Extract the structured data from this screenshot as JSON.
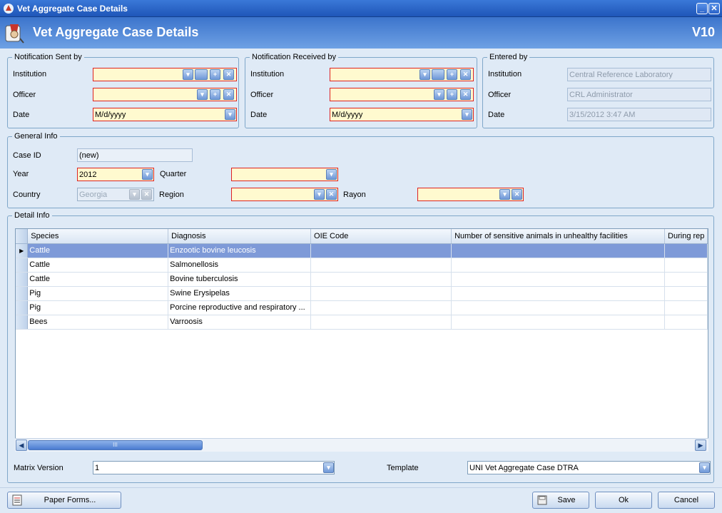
{
  "window": {
    "title": "Vet Aggregate Case Details"
  },
  "header": {
    "title": "Vet Aggregate Case Details",
    "version": "V10"
  },
  "sent_by": {
    "legend": "Notification Sent by",
    "institution_label": "Institution",
    "institution_value": "",
    "officer_label": "Officer",
    "officer_value": "",
    "date_label": "Date",
    "date_value": "M/d/yyyy"
  },
  "received_by": {
    "legend": "Notification Received by",
    "institution_label": "Institution",
    "institution_value": "",
    "officer_label": "Officer",
    "officer_value": "",
    "date_label": "Date",
    "date_value": "M/d/yyyy"
  },
  "entered_by": {
    "legend": "Entered by",
    "institution_label": "Institution",
    "institution_value": "Central Reference Laboratory",
    "officer_label": "Officer",
    "officer_value": "CRL Administrator",
    "date_label": "Date",
    "date_value": "3/15/2012 3:47 AM"
  },
  "general": {
    "legend": "General Info",
    "case_id_label": "Case ID",
    "case_id_value": "(new)",
    "year_label": "Year",
    "year_value": "2012",
    "quarter_label": "Quarter",
    "quarter_value": "",
    "country_label": "Country",
    "country_value": "Georgia",
    "region_label": "Region",
    "region_value": "",
    "rayon_label": "Rayon",
    "rayon_value": ""
  },
  "detail": {
    "legend": "Detail Info",
    "columns": [
      "Species",
      "Diagnosis",
      "OIE Code",
      "Number of sensitive animals in unhealthy facilities",
      "During rep"
    ],
    "rows": [
      {
        "species": "Cattle",
        "diagnosis": "Enzootic bovine leucosis",
        "oie": "",
        "number": "",
        "during": ""
      },
      {
        "species": "Cattle",
        "diagnosis": "Salmonellosis",
        "oie": "",
        "number": "",
        "during": ""
      },
      {
        "species": "Cattle",
        "diagnosis": "Bovine tuberculosis",
        "oie": "",
        "number": "",
        "during": ""
      },
      {
        "species": "Pig",
        "diagnosis": "Swine Erysipelas",
        "oie": "",
        "number": "",
        "during": ""
      },
      {
        "species": "Pig",
        "diagnosis": "Porcine reproductive and respiratory ...",
        "oie": "",
        "number": "",
        "during": ""
      },
      {
        "species": "Bees",
        "diagnosis": "Varroosis",
        "oie": "",
        "number": "",
        "during": ""
      }
    ],
    "scroll_thumb_grip": "III"
  },
  "matrix": {
    "label": "Matrix Version",
    "value": "1"
  },
  "template": {
    "label": "Template",
    "value": "UNI Vet Aggregate Case DTRA"
  },
  "buttons": {
    "paper_forms": "Paper Forms...",
    "save": "Save",
    "ok": "Ok",
    "cancel": "Cancel"
  },
  "icons": {
    "dropdown": "▾",
    "add": "+",
    "clear": "✕",
    "browse": "browse-icon",
    "row_pointer": "▶",
    "scroll_left": "◀",
    "scroll_right": "▶",
    "minimize": "_",
    "close": "✕"
  },
  "colors": {
    "required_border": "#dd2222",
    "required_fill": "#fffacf",
    "selected_row": "#7e9ad8",
    "header_blue": "#3c74cc"
  }
}
